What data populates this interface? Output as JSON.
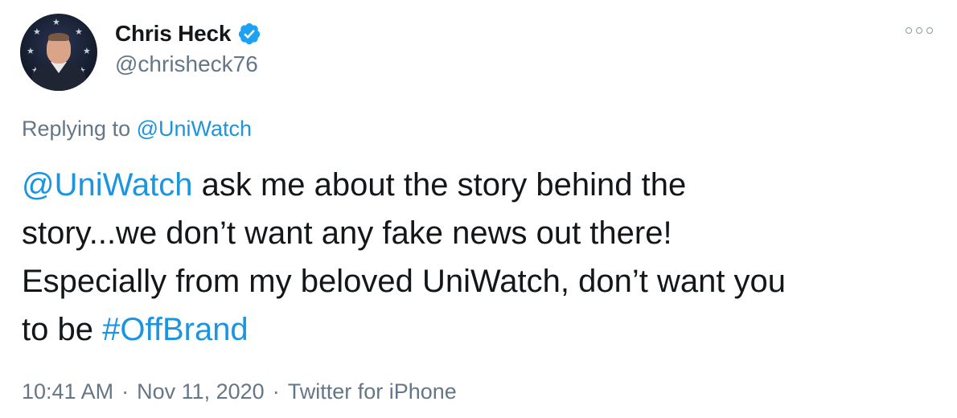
{
  "author": {
    "name": "Chris Heck",
    "handle": "@chrisheck76",
    "verified": true
  },
  "reply": {
    "prefix": "Replying to ",
    "mention": "@UniWatch"
  },
  "tweet": {
    "mention": "@UniWatch",
    "line1": " ask me about the story behind the",
    "line2": "story...we don’t want any fake news out there!",
    "line3": "Especially from my beloved UniWatch, don’t want you",
    "line4_prefix": "to be ",
    "hashtag": "#OffBrand"
  },
  "meta": {
    "time": "10:41 AM",
    "separator": "·",
    "date": "Nov 11, 2020",
    "source": "Twitter for iPhone"
  },
  "icons": {
    "verified": "verified-badge-icon",
    "more": "more-options-icon"
  },
  "colors": {
    "link": "#1b95e0",
    "muted": "#657786",
    "text": "#14171a",
    "verified": "#1da1f2"
  }
}
